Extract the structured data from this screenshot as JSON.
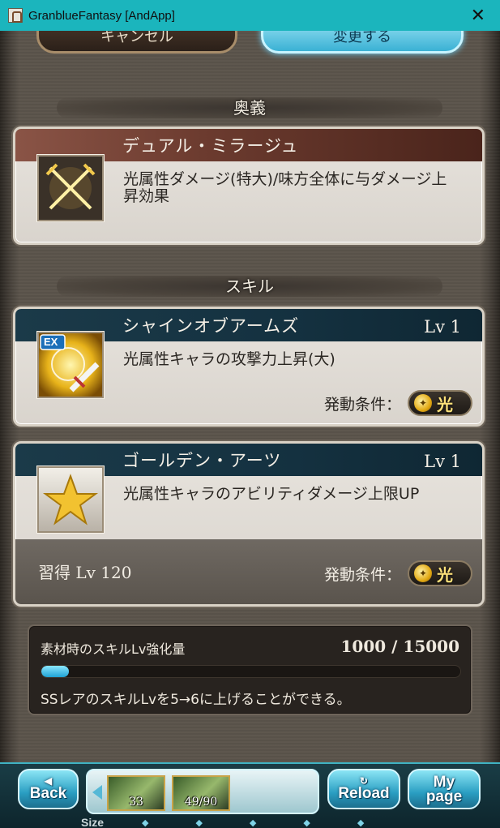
{
  "window": {
    "title": "GranblueFantasy [AndApp]",
    "close_glyph": "✕"
  },
  "top_buttons": {
    "cancel_label": "キャンセル",
    "change_label": "変更する"
  },
  "sections": {
    "ougi_label": "奥義",
    "skill_label": "スキル"
  },
  "ougi": {
    "name": "デュアル・ミラージュ",
    "description": "光属性ダメージ(特大)/味方全体に与ダメージ上昇効果",
    "icon": "crossed-swords-icon"
  },
  "skills": [
    {
      "name": "シャインオブアームズ",
      "level": "Lv 1",
      "description": "光属性キャラの攻撃力上昇(大)",
      "icon": "ex-sword-skill-icon",
      "icon_badge": "EX",
      "condition_label": "発動条件：",
      "condition_element": "光"
    },
    {
      "name": "ゴールデン・アーツ",
      "level": "Lv 1",
      "description": "光属性キャラのアビリティダメージ上限UP",
      "icon": "gold-star-icon",
      "acquire_label": "習得",
      "acquire_level": "Lv 120",
      "condition_label": "発動条件：",
      "condition_element": "光"
    }
  ],
  "enhancement": {
    "title": "素材時のスキルLv強化量",
    "value": "1000 / 15000",
    "progress_fraction": 0.0667,
    "note": "SSレアのスキルLvを5→6に上げることができる。"
  },
  "toolbar": {
    "back_label": "Back",
    "reload_label": "Reload",
    "mypage_label_1": "My",
    "mypage_label_2": "page",
    "items": [
      {
        "count": "33",
        "icon": "herb-icon"
      },
      {
        "count": "49/90",
        "icon": "potion-icon"
      }
    ],
    "size_label": "Size"
  },
  "colors": {
    "accent": "#1bb5bd",
    "light_element": "#ffe27a",
    "skill_header": "#143140",
    "ougi_header": "#6c3b2f"
  }
}
